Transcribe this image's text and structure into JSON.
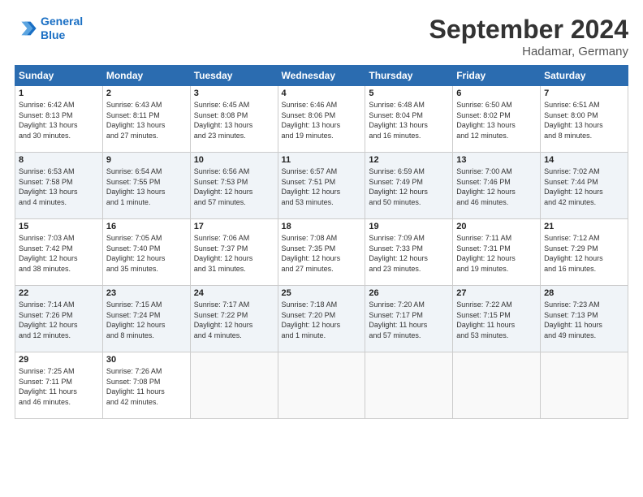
{
  "header": {
    "logo_line1": "General",
    "logo_line2": "Blue",
    "month": "September 2024",
    "location": "Hadamar, Germany"
  },
  "weekdays": [
    "Sunday",
    "Monday",
    "Tuesday",
    "Wednesday",
    "Thursday",
    "Friday",
    "Saturday"
  ],
  "weeks": [
    [
      {
        "day": "1",
        "info": "Sunrise: 6:42 AM\nSunset: 8:13 PM\nDaylight: 13 hours\nand 30 minutes."
      },
      {
        "day": "2",
        "info": "Sunrise: 6:43 AM\nSunset: 8:11 PM\nDaylight: 13 hours\nand 27 minutes."
      },
      {
        "day": "3",
        "info": "Sunrise: 6:45 AM\nSunset: 8:08 PM\nDaylight: 13 hours\nand 23 minutes."
      },
      {
        "day": "4",
        "info": "Sunrise: 6:46 AM\nSunset: 8:06 PM\nDaylight: 13 hours\nand 19 minutes."
      },
      {
        "day": "5",
        "info": "Sunrise: 6:48 AM\nSunset: 8:04 PM\nDaylight: 13 hours\nand 16 minutes."
      },
      {
        "day": "6",
        "info": "Sunrise: 6:50 AM\nSunset: 8:02 PM\nDaylight: 13 hours\nand 12 minutes."
      },
      {
        "day": "7",
        "info": "Sunrise: 6:51 AM\nSunset: 8:00 PM\nDaylight: 13 hours\nand 8 minutes."
      }
    ],
    [
      {
        "day": "8",
        "info": "Sunrise: 6:53 AM\nSunset: 7:58 PM\nDaylight: 13 hours\nand 4 minutes."
      },
      {
        "day": "9",
        "info": "Sunrise: 6:54 AM\nSunset: 7:55 PM\nDaylight: 13 hours\nand 1 minute."
      },
      {
        "day": "10",
        "info": "Sunrise: 6:56 AM\nSunset: 7:53 PM\nDaylight: 12 hours\nand 57 minutes."
      },
      {
        "day": "11",
        "info": "Sunrise: 6:57 AM\nSunset: 7:51 PM\nDaylight: 12 hours\nand 53 minutes."
      },
      {
        "day": "12",
        "info": "Sunrise: 6:59 AM\nSunset: 7:49 PM\nDaylight: 12 hours\nand 50 minutes."
      },
      {
        "day": "13",
        "info": "Sunrise: 7:00 AM\nSunset: 7:46 PM\nDaylight: 12 hours\nand 46 minutes."
      },
      {
        "day": "14",
        "info": "Sunrise: 7:02 AM\nSunset: 7:44 PM\nDaylight: 12 hours\nand 42 minutes."
      }
    ],
    [
      {
        "day": "15",
        "info": "Sunrise: 7:03 AM\nSunset: 7:42 PM\nDaylight: 12 hours\nand 38 minutes."
      },
      {
        "day": "16",
        "info": "Sunrise: 7:05 AM\nSunset: 7:40 PM\nDaylight: 12 hours\nand 35 minutes."
      },
      {
        "day": "17",
        "info": "Sunrise: 7:06 AM\nSunset: 7:37 PM\nDaylight: 12 hours\nand 31 minutes."
      },
      {
        "day": "18",
        "info": "Sunrise: 7:08 AM\nSunset: 7:35 PM\nDaylight: 12 hours\nand 27 minutes."
      },
      {
        "day": "19",
        "info": "Sunrise: 7:09 AM\nSunset: 7:33 PM\nDaylight: 12 hours\nand 23 minutes."
      },
      {
        "day": "20",
        "info": "Sunrise: 7:11 AM\nSunset: 7:31 PM\nDaylight: 12 hours\nand 19 minutes."
      },
      {
        "day": "21",
        "info": "Sunrise: 7:12 AM\nSunset: 7:29 PM\nDaylight: 12 hours\nand 16 minutes."
      }
    ],
    [
      {
        "day": "22",
        "info": "Sunrise: 7:14 AM\nSunset: 7:26 PM\nDaylight: 12 hours\nand 12 minutes."
      },
      {
        "day": "23",
        "info": "Sunrise: 7:15 AM\nSunset: 7:24 PM\nDaylight: 12 hours\nand 8 minutes."
      },
      {
        "day": "24",
        "info": "Sunrise: 7:17 AM\nSunset: 7:22 PM\nDaylight: 12 hours\nand 4 minutes."
      },
      {
        "day": "25",
        "info": "Sunrise: 7:18 AM\nSunset: 7:20 PM\nDaylight: 12 hours\nand 1 minute."
      },
      {
        "day": "26",
        "info": "Sunrise: 7:20 AM\nSunset: 7:17 PM\nDaylight: 11 hours\nand 57 minutes."
      },
      {
        "day": "27",
        "info": "Sunrise: 7:22 AM\nSunset: 7:15 PM\nDaylight: 11 hours\nand 53 minutes."
      },
      {
        "day": "28",
        "info": "Sunrise: 7:23 AM\nSunset: 7:13 PM\nDaylight: 11 hours\nand 49 minutes."
      }
    ],
    [
      {
        "day": "29",
        "info": "Sunrise: 7:25 AM\nSunset: 7:11 PM\nDaylight: 11 hours\nand 46 minutes."
      },
      {
        "day": "30",
        "info": "Sunrise: 7:26 AM\nSunset: 7:08 PM\nDaylight: 11 hours\nand 42 minutes."
      },
      {
        "day": "",
        "info": ""
      },
      {
        "day": "",
        "info": ""
      },
      {
        "day": "",
        "info": ""
      },
      {
        "day": "",
        "info": ""
      },
      {
        "day": "",
        "info": ""
      }
    ]
  ]
}
